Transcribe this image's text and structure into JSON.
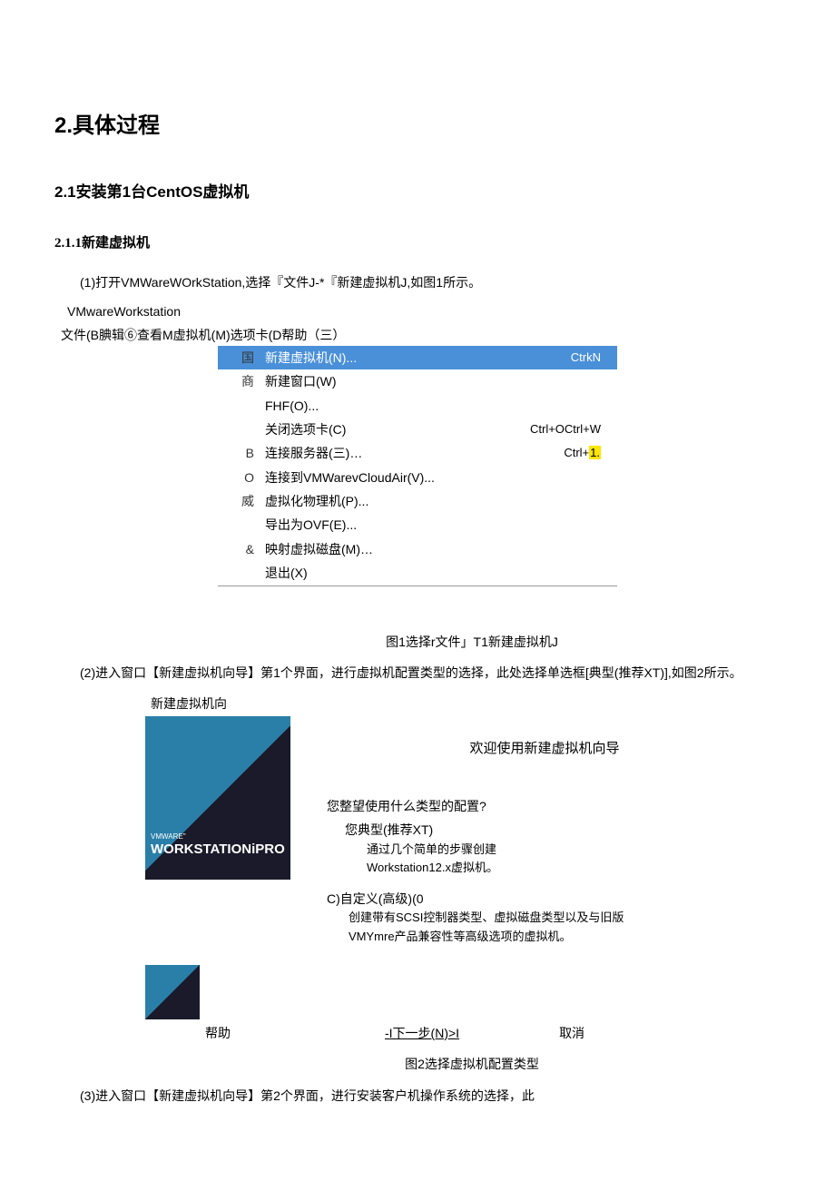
{
  "headings": {
    "h1": "2.具体过程",
    "h2": "2.1安装第1台CentOS虚拟机",
    "h3": "2.1.1新建虚拟机"
  },
  "step1": "(1)打开VMWareWOrkStation,选择『文件J-*『新建虚拟机J,如图1所示。",
  "fig1": {
    "app_title": "VMwareWorkstation",
    "menu_bar": "文件(B腆辑⑥查看M虚拟机(M)选项卡(D帮助（三）",
    "left": {
      "r1": "国",
      "r2": "商",
      "r5": "B",
      "r6": "O",
      "r7": "威",
      "r9": "&"
    },
    "items": {
      "new_vm": "新建虚拟机(N)...",
      "new_win": "新建窗口(W)",
      "fhf": "FHF(O)...",
      "close_tab": "关闭选项卡(C)",
      "connect_server": "连接服务器(三)…",
      "connect_cloud": "连接到VMWarevCloudAir(V)...",
      "virtualize": "虚拟化物理机(P)...",
      "export_ovf": "导出为OVF(E)...",
      "map_disk": "映射虚拟磁盘(M)…",
      "exit": "退出(X)"
    },
    "shortcuts": {
      "new_vm": "CtrkN",
      "close_tab": "Ctrl+OCtrl+W",
      "connect_server_pre": "Ctrl+",
      "connect_server_hl": "1."
    }
  },
  "caption1": "图1选择r文件」T1新建虚拟机J",
  "step2": "(2)进入窗口【新建虚拟机向导】第1个界面，进行虚拟机配置类型的选择，此处选择单选框[典型(推荐XT)],如图2所示。",
  "fig2": {
    "title": "新建虚拟机向",
    "img_small": "VMWARE\"",
    "img_big": "WORKSTATIONiPRO",
    "welcome": "欢迎使用新建虚拟机向导",
    "question": "您整望使用什么类型的配置?",
    "opt1_title": "您典型(推荐XT)",
    "opt1_desc1": "通过几个简单的步骤创建",
    "opt1_desc2": "Workstation12.x虚拟机。",
    "opt2_title": "C)自定义(高级)(0",
    "opt2_desc1": "创建带有SCSI控制器类型、虚拟磁盘类型以及与旧版",
    "opt2_desc2": "VMYmre产品兼容性等高级选项的虚拟机。",
    "help": "帮助",
    "next": "-I下一步(N)>I",
    "cancel": "取消"
  },
  "caption2": "图2选择虚拟机配置类型",
  "step3": "(3)进入窗口【新建虚拟机向导】第2个界面，进行安装客户机操作系统的选择，此"
}
